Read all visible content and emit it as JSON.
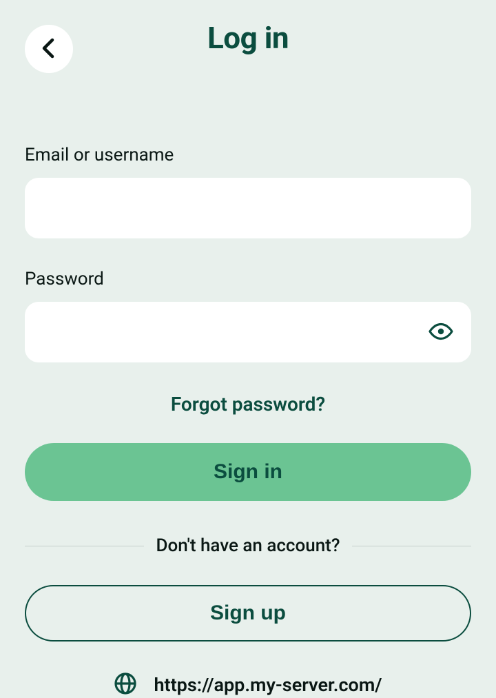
{
  "header": {
    "title": "Log in"
  },
  "form": {
    "email_label": "Email or username",
    "email_value": "",
    "password_label": "Password",
    "password_value": ""
  },
  "links": {
    "forgot": "Forgot password?"
  },
  "buttons": {
    "signin": "Sign in",
    "signup": "Sign up"
  },
  "divider": {
    "text": "Don't have an account?"
  },
  "server": {
    "url": "https://app.my-server.com/"
  },
  "icons": {
    "back": "back-icon",
    "eye": "eye-icon",
    "globe": "globe-icon"
  },
  "colors": {
    "bg": "#e8f0ec",
    "primary": "#0b4d3f",
    "accent": "#6bc493",
    "white": "#ffffff"
  }
}
